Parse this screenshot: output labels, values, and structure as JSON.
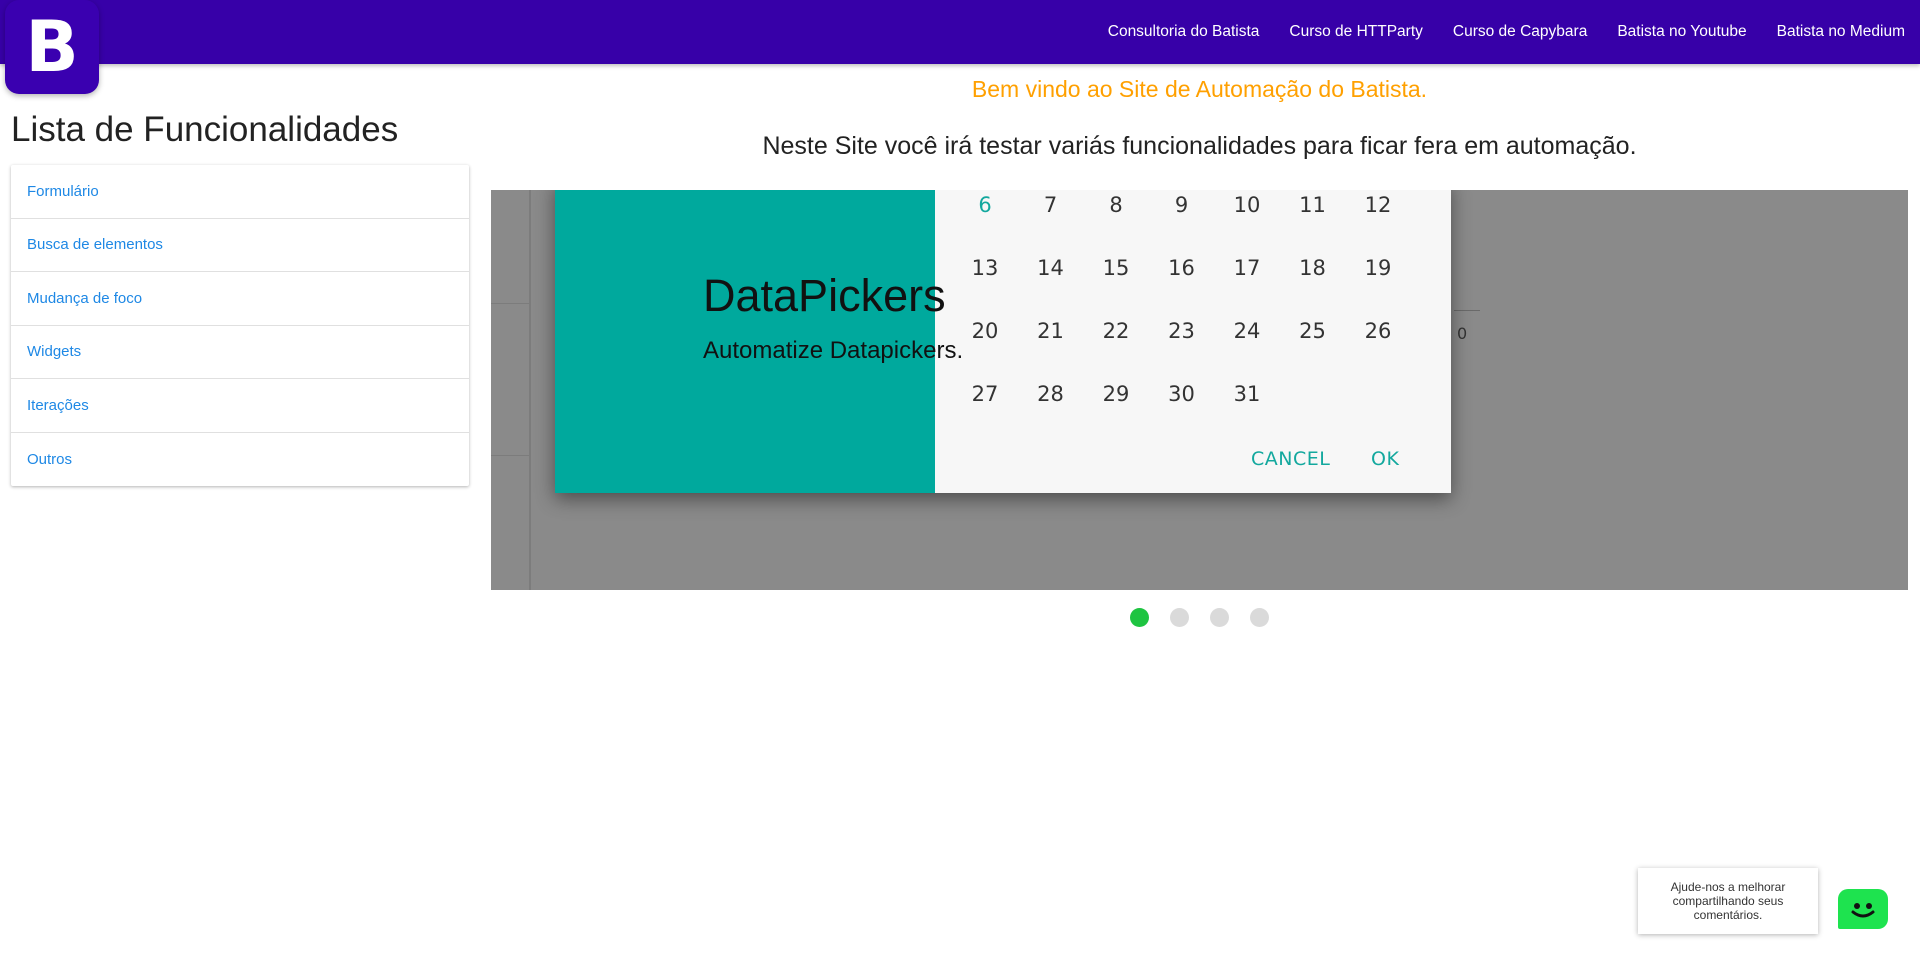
{
  "brand": {
    "logo_letter": "B"
  },
  "nav": {
    "links": [
      "Consultoria do Batista",
      "Curso de HTTParty",
      "Curso de Capybara",
      "Batista no Youtube",
      "Batista no Medium"
    ]
  },
  "sidebar": {
    "title": "Lista de Funcionalidades",
    "items": [
      "Formulário",
      "Busca de elementos",
      "Mudança de foco",
      "Widgets",
      "Iterações",
      "Outros"
    ]
  },
  "main": {
    "welcome": "Bem vindo ao Site de Automação do Batista.",
    "subtitle": "Neste Site você irá testar variás funcionalidades para ficar fera em automação."
  },
  "carousel": {
    "active_index": 0,
    "slide_count": 4,
    "caption_title": "DataPickers",
    "caption_text": "Automatize Datapickers.",
    "background_axis_label": "0",
    "calendar": {
      "rows": [
        [
          "6",
          "7",
          "8",
          "9",
          "10",
          "11",
          "12"
        ],
        [
          "13",
          "14",
          "15",
          "16",
          "17",
          "18",
          "19"
        ],
        [
          "20",
          "21",
          "22",
          "23",
          "24",
          "25",
          "26"
        ],
        [
          "27",
          "28",
          "29",
          "30",
          "31"
        ]
      ],
      "selected_day": "6",
      "cancel_label": "CANCEL",
      "ok_label": "OK"
    }
  },
  "feedback": {
    "text": "Ajude-nos a melhorar compartilhando seus comentários."
  },
  "colors": {
    "navbar": "#3700a8",
    "accent_orange": "#ffa000",
    "link_blue": "#1e88e5",
    "teal": "#00a99d",
    "indicator_active": "#1ec441",
    "feedback_green": "#1ee34f"
  }
}
